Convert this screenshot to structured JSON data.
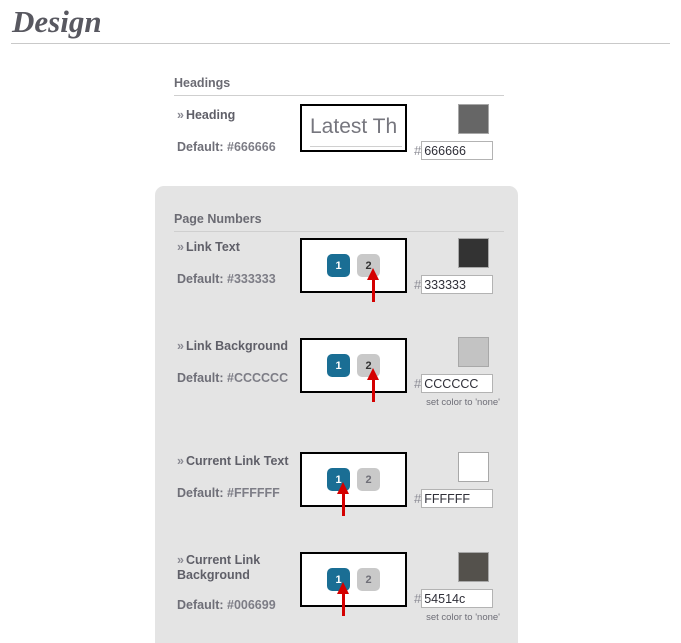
{
  "page": {
    "title": "Design"
  },
  "headings_section": {
    "heading": "Headings",
    "row": {
      "label": "Heading",
      "chevron": "»",
      "default_text": "Default: ",
      "default_value": "#666666",
      "preview_text": "Latest Th",
      "hash": "#",
      "hex_value": "666666",
      "swatch_color": "#666666"
    }
  },
  "page_numbers_section": {
    "heading": "Page Numbers",
    "rows": [
      {
        "label": "Link Text",
        "chevron": "»",
        "default_text": "Default: ",
        "default_value": "#333333",
        "hash": "#",
        "hex_value": "333333",
        "swatch_color": "#333333",
        "pager": {
          "buttons": [
            {
              "label": "1",
              "bg": "#1a6e94",
              "fg": "#ffffff"
            },
            {
              "label": "2",
              "bg": "#c9c9c9",
              "fg": "#333333"
            }
          ],
          "arrow_target": "2"
        },
        "none_link": ""
      },
      {
        "label": "Link Background",
        "chevron": "»",
        "default_text": "Default: ",
        "default_value": "#CCCCCC",
        "hash": "#",
        "hex_value": "CCCCCC",
        "swatch_color": "#c3c3c3",
        "pager": {
          "buttons": [
            {
              "label": "1",
              "bg": "#1a6e94",
              "fg": "#ffffff"
            },
            {
              "label": "2",
              "bg": "#c9c9c9",
              "fg": "#333333"
            }
          ],
          "arrow_target": "2"
        },
        "none_link": "set color to 'none'"
      },
      {
        "label": "Current Link Text",
        "chevron": "»",
        "default_text": "Default: ",
        "default_value": "#FFFFFF",
        "hash": "#",
        "hex_value": "FFFFFF",
        "swatch_color": "#ffffff",
        "pager": {
          "buttons": [
            {
              "label": "1",
              "bg": "#1a6e94",
              "fg": "#ffffff"
            },
            {
              "label": "2",
              "bg": "#c9c9c9",
              "fg": "#6f6f78"
            }
          ],
          "arrow_target": "1"
        },
        "none_link": ""
      },
      {
        "label": "Current Link Background",
        "chevron": "»",
        "default_text": "Default: ",
        "default_value": "#006699",
        "hash": "#",
        "hex_value": "54514c",
        "swatch_color": "#54514c",
        "pager": {
          "buttons": [
            {
              "label": "1",
              "bg": "#1a6e94",
              "fg": "#ffffff"
            },
            {
              "label": "2",
              "bg": "#c9c9c9",
              "fg": "#6f6f78"
            }
          ],
          "arrow_target": "1"
        },
        "none_link": "set color to 'none'"
      }
    ]
  }
}
